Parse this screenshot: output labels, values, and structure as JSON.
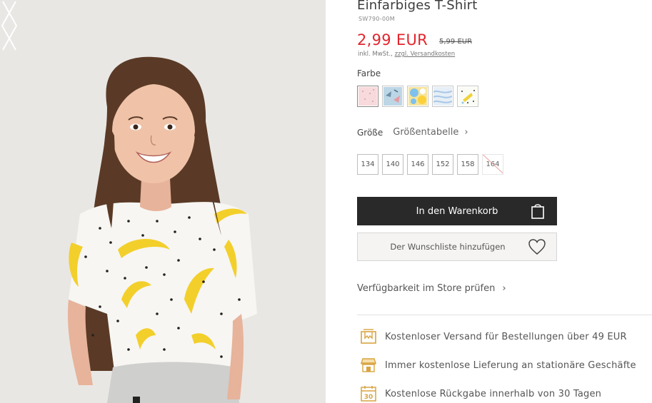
{
  "product": {
    "title": "Einfarbiges T-Shirt",
    "sku": "SW790-00M",
    "price": "2,99 EUR",
    "old_price": "5,99 EUR",
    "tax_note": "inkl. MwSt.,",
    "shipping_link": "zzgl. Versandkosten"
  },
  "colors": {
    "label": "Farbe",
    "swatches": [
      {
        "name": "pink-dots"
      },
      {
        "name": "blue-pattern"
      },
      {
        "name": "yellow-floral"
      },
      {
        "name": "light-blue-waves"
      },
      {
        "name": "white-pattern"
      }
    ]
  },
  "size": {
    "label": "Größe",
    "chart_link": "Größentabelle",
    "options": [
      {
        "label": "134",
        "available": true
      },
      {
        "label": "140",
        "available": true
      },
      {
        "label": "146",
        "available": true
      },
      {
        "label": "152",
        "available": true
      },
      {
        "label": "158",
        "available": true
      },
      {
        "label": "164",
        "available": false
      }
    ]
  },
  "actions": {
    "add_to_cart": "In den Warenkorb",
    "add_to_wishlist": "Der Wunschliste hinzufügen",
    "store_availability": "Verfügbarkeit im Store prüfen"
  },
  "benefits": [
    {
      "icon": "delivery-box-icon",
      "text": "Kostenloser Versand für Bestellungen über 49 EUR"
    },
    {
      "icon": "store-icon",
      "text": "Immer kostenlose Lieferung an stationäre Geschäfte"
    },
    {
      "icon": "calendar-30-icon",
      "text": "Kostenlose Rückgabe innerhalb von 30 Tagen",
      "badge": "30"
    }
  ],
  "colors_theme": {
    "price_red": "#e2242d",
    "button_dark": "#292929",
    "benefit_icon": "#d9a441"
  }
}
